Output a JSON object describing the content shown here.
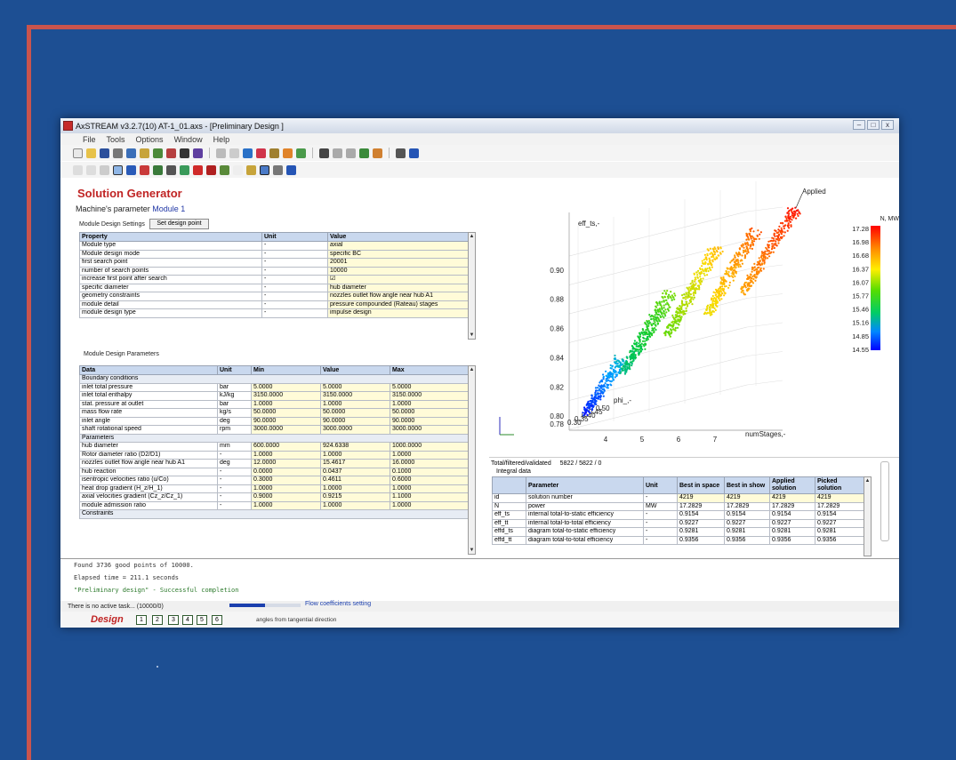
{
  "window": {
    "title": "AxSTREAM  v3.2.7(10)   AT-1_01.axs - [Preliminary Design  ]"
  },
  "menu": [
    "File",
    "Tools",
    "Options",
    "Window",
    "Help"
  ],
  "solution_generator": {
    "title": "Solution Generator",
    "machine_param_label": "Machine's parameter",
    "machine_param_value": "Module 1",
    "settings_label": "Module Design Settings",
    "set_design_point_label": "Set design point",
    "settings_table": {
      "headers": [
        "Property",
        "Unit",
        "Value"
      ],
      "rows": [
        [
          "Module type",
          "-",
          "axial"
        ],
        [
          "Module design mode",
          "-",
          "specific BC"
        ],
        [
          "first search point",
          "-",
          "20001"
        ],
        [
          "number of search points",
          "-",
          "10000"
        ],
        [
          "increase first point after search",
          "-",
          "☑"
        ],
        [
          "specific diameter",
          "-",
          "hub diameter"
        ],
        [
          "geometry constraints",
          "-",
          "nozzles outlet flow angle near hub A1"
        ],
        [
          "module detail",
          "-",
          "pressure compounded (Rateau) stages"
        ],
        [
          "module design type",
          "-",
          "impulse design"
        ]
      ]
    },
    "params_label": "Module Design Parameters",
    "params_table": {
      "headers": [
        "Data",
        "Unit",
        "Min",
        "Value",
        "Max"
      ],
      "rows": [
        {
          "section": "Boundary conditions"
        },
        {
          "cells": [
            "inlet total pressure",
            "bar",
            "5.0000",
            "5.0000",
            "5.0000"
          ]
        },
        {
          "cells": [
            "inlet total enthalpy",
            "kJ/kg",
            "3150.0000",
            "3150.0000",
            "3150.0000"
          ]
        },
        {
          "cells": [
            "stat. pressure at outlet",
            "bar",
            "1.0000",
            "1.0000",
            "1.0000"
          ]
        },
        {
          "cells": [
            "mass flow rate",
            "kg/s",
            "50.0000",
            "50.0000",
            "50.0000"
          ]
        },
        {
          "cells": [
            "inlet angle",
            "deg",
            "90.0000",
            "90.0000",
            "90.0000"
          ]
        },
        {
          "cells": [
            "shaft rotational speed",
            "rpm",
            "3000.0000",
            "3000.0000",
            "3000.0000"
          ]
        },
        {
          "section": "Parameters"
        },
        {
          "cells": [
            "hub diameter",
            "mm",
            "600.0000",
            "924.6338",
            "1000.0000"
          ]
        },
        {
          "cells": [
            "Rotor diameter ratio (D2/D1)",
            "-",
            "1.0000",
            "1.0000",
            "1.0000"
          ]
        },
        {
          "cells": [
            "nozzles outlet flow angle near hub A1",
            "deg",
            "12.0000",
            "15.4617",
            "16.0000"
          ]
        },
        {
          "cells": [
            "hub reaction",
            "-",
            "0.0000",
            "0.0437",
            "0.1000"
          ]
        },
        {
          "cells": [
            "isentropic velocities ratio (u/Co)",
            "-",
            "0.3000",
            "0.4611",
            "0.6000"
          ]
        },
        {
          "cells": [
            "heat drop gradient (H_z/H_1)",
            "-",
            "1.0000",
            "1.0000",
            "1.0000"
          ]
        },
        {
          "cells": [
            "axial velocities gradient (Cz_z/Cz_1)",
            "-",
            "0.9000",
            "0.9215",
            "1.1000"
          ]
        },
        {
          "cells": [
            "module admission ratio",
            "-",
            "1.0000",
            "1.0000",
            "1.0000"
          ]
        },
        {
          "section": "Constraints"
        }
      ]
    }
  },
  "chart": {
    "applied_label": "Applied",
    "zaxis_label": "eff_ts,-",
    "y_tick_labels": [
      "0.90",
      "0.88",
      "0.86",
      "0.84",
      "0.82",
      "0.80",
      "0.78"
    ],
    "x_tick_labels": [
      "4",
      "5",
      "6",
      "7"
    ],
    "x_axis_label": "numStages,-",
    "phi_label": "phi_,-",
    "phi_ticks": [
      "0.50",
      "0.45",
      "0.40",
      "0.35",
      "0.30"
    ],
    "colorbar_title": "N, MW",
    "colorbar_ticks": [
      "17.28",
      "16.98",
      "16.68",
      "16.37",
      "16.07",
      "15.77",
      "15.46",
      "15.16",
      "14.85",
      "14.55"
    ],
    "colors": {
      "high": "#ff0000",
      "mid": "#33cc00",
      "low": "#0000ff"
    }
  },
  "chart_data": {
    "type": "scatter",
    "xlabel": "numStages,-",
    "zlabel": "eff_ts,-",
    "ylabel": "phi_,-",
    "colorbar": "N, MW",
    "xlim": [
      3,
      8
    ],
    "zlim": [
      0.78,
      0.92
    ],
    "colorbar_range": [
      14.55,
      17.28
    ],
    "clusters": [
      {
        "numStages": 3,
        "eff_ts_range": [
          0.78,
          0.815
        ]
      },
      {
        "numStages": 4,
        "eff_ts_range": [
          0.8,
          0.86
        ]
      },
      {
        "numStages": 5,
        "eff_ts_range": [
          0.83,
          0.885
        ]
      },
      {
        "numStages": 6,
        "eff_ts_range": [
          0.855,
          0.905
        ]
      },
      {
        "numStages": 7,
        "eff_ts_range": [
          0.87,
          0.915
        ]
      }
    ]
  },
  "results": {
    "summary_label": "Total/filtered/validated",
    "summary_value": "5822 / 5822 / 0",
    "integral_label": "Integral data",
    "headers": [
      "",
      "Parameter",
      "Unit",
      "Best in space",
      "Best in show",
      "Applied solution",
      "Picked solution"
    ],
    "rows": [
      [
        "id",
        "solution number",
        "-",
        "4219",
        "4219",
        "4219",
        "4219"
      ],
      [
        "N",
        "power",
        "MW",
        "17.2829",
        "17.2829",
        "17.2829",
        "17.2829"
      ],
      [
        "eff_ts",
        "internal total-to-static efficiency",
        "-",
        "0.9154",
        "0.9154",
        "0.9154",
        "0.9154"
      ],
      [
        "eff_tt",
        "internal total-to-total efficiency",
        "-",
        "0.9227",
        "0.9227",
        "0.9227",
        "0.9227"
      ],
      [
        "effd_ts",
        "diagram total-to-static efficiency",
        "-",
        "0.9281",
        "0.9281",
        "0.9281",
        "0.9281"
      ],
      [
        "effd_tt",
        "diagram total-to-total efficiency",
        "-",
        "0.9356",
        "0.9356",
        "0.9356",
        "0.9356"
      ]
    ]
  },
  "log": {
    "line1": "Found 3736 good points of 10000.",
    "line2": "Elapsed time = 211.1 seconds",
    "line3": "\"Preliminary design\" - Successful completion"
  },
  "status": {
    "task": "There is no active task... (10000/0)",
    "progress_caption": "Flow coefficients setting",
    "progress_fraction": 0.5
  },
  "bottom": {
    "design_label": "Design",
    "stages": [
      "1",
      "2",
      "3",
      "4",
      "5",
      "6"
    ],
    "hint": "angles from tangential direction"
  }
}
